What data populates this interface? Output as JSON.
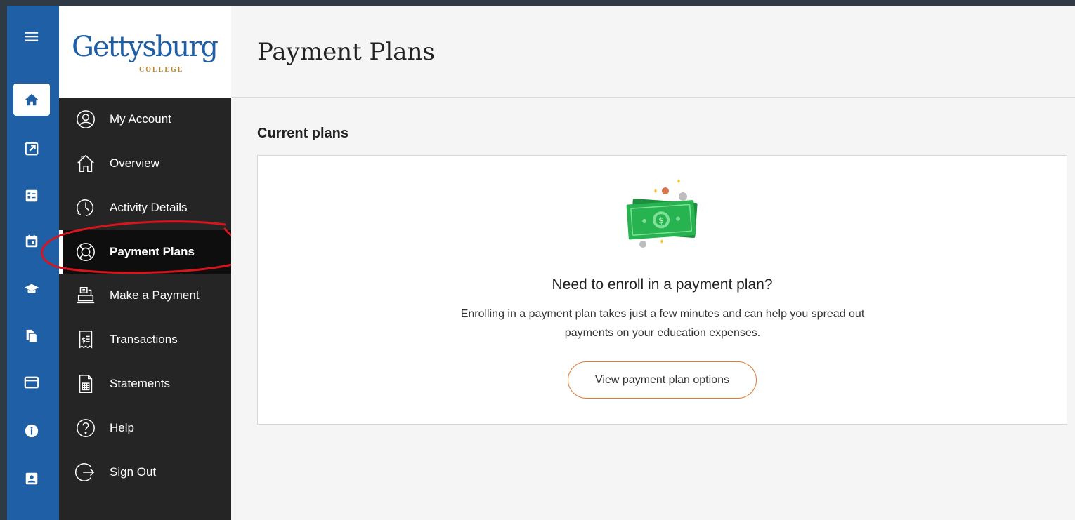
{
  "logo": {
    "word": "Gettysburg",
    "sub": "COLLEGE"
  },
  "rail": {
    "items": [
      {
        "icon": "menu-icon"
      },
      {
        "icon": "home-icon",
        "active": true
      },
      {
        "icon": "external-link-icon"
      },
      {
        "icon": "list-icon"
      },
      {
        "icon": "calendar-icon"
      },
      {
        "icon": "graduation-cap-icon"
      },
      {
        "icon": "documents-icon"
      },
      {
        "icon": "credit-card-icon"
      },
      {
        "icon": "info-icon"
      },
      {
        "icon": "contact-card-icon"
      }
    ]
  },
  "sidebar": {
    "items": [
      {
        "label": "My Account",
        "icon": "user-circle-icon"
      },
      {
        "label": "Overview",
        "icon": "house-icon"
      },
      {
        "label": "Activity Details",
        "icon": "clock-icon"
      },
      {
        "label": "Payment Plans",
        "icon": "lifebuoy-icon",
        "active": true
      },
      {
        "label": "Make a Payment",
        "icon": "cash-register-icon"
      },
      {
        "label": "Transactions",
        "icon": "receipt-icon"
      },
      {
        "label": "Statements",
        "icon": "statement-icon"
      },
      {
        "label": "Help",
        "icon": "help-circle-icon"
      },
      {
        "label": "Sign Out",
        "icon": "sign-out-icon"
      }
    ]
  },
  "header": {
    "title": "Payment Plans"
  },
  "main": {
    "section_title": "Current plans",
    "card": {
      "heading": "Need to enroll in a payment plan?",
      "text": "Enrolling in a payment plan takes just a few minutes and can help you spread out payments on your education expenses.",
      "button_label": "View payment plan options"
    }
  },
  "colors": {
    "rail": "#1f5fa6",
    "sidebar": "#252525",
    "accent_button": "#e07a2e",
    "annotation": "#d8141c",
    "money_green": "#27b34f"
  }
}
